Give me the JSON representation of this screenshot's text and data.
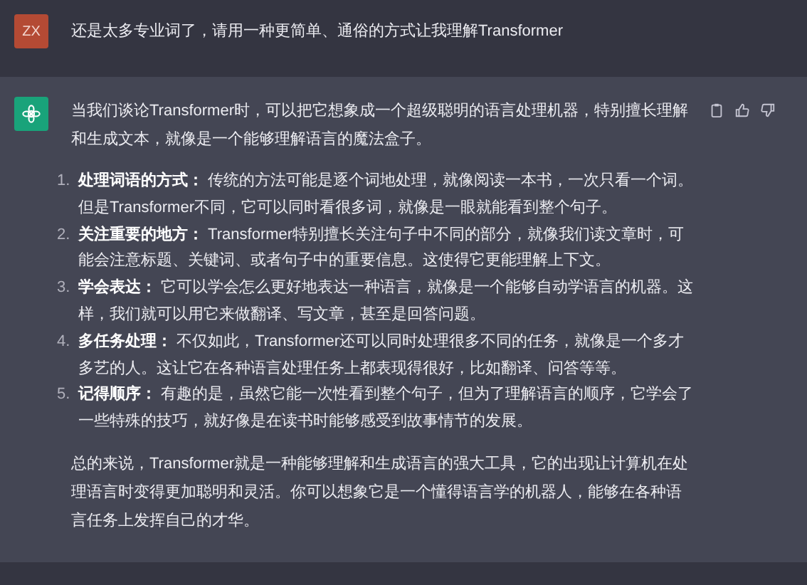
{
  "user_message": {
    "avatar": "ZX",
    "text": "还是太多专业词了，请用一种更简单、通俗的方式让我理解Transformer"
  },
  "assistant_message": {
    "intro": "当我们谈论Transformer时，可以把它想象成一个超级聪明的语言处理机器，特别擅长理解和生成文本，就像是一个能够理解语言的魔法盒子。",
    "items": [
      {
        "number": "1.",
        "text": "**处理词语的方式：** 传统的方法可能是逐个词地处理，就像阅读一本书，一次只看一个词。但是Transformer不同，它可以同时看很多词，就像是一眼就能看到整个句子。"
      },
      {
        "number": "2.",
        "text": "**关注重要的地方：** Transformer特别擅长关注句子中不同的部分，就像我们读文章时，可能会注意标题、关键词、或者句子中的重要信息。这使得它更能理解上下文。"
      },
      {
        "number": "3.",
        "text": "**学会表达：** 它可以学会怎么更好地表达一种语言，就像是一个能够自动学语言的机器。这样，我们就可以用它来做翻译、写文章，甚至是回答问题。"
      },
      {
        "number": "4.",
        "text": "**多任务处理：** 不仅如此，Transformer还可以同时处理很多不同的任务，就像是一个多才多艺的人。这让它在各种语言处理任务上都表现得很好，比如翻译、问答等等。"
      },
      {
        "number": "5.",
        "text": "**记得顺序：** 有趣的是，虽然它能一次性看到整个句子，但为了理解语言的顺序，它学会了一些特殊的技巧，就好像是在读书时能够感受到故事情节的发展。"
      }
    ],
    "summary": "总的来说，Transformer就是一种能够理解和生成语言的强大工具，它的出现让计算机在处理语言时变得更加聪明和灵活。你可以想象它是一个懂得语言学的机器人，能够在各种语言任务上发挥自己的才华。"
  }
}
